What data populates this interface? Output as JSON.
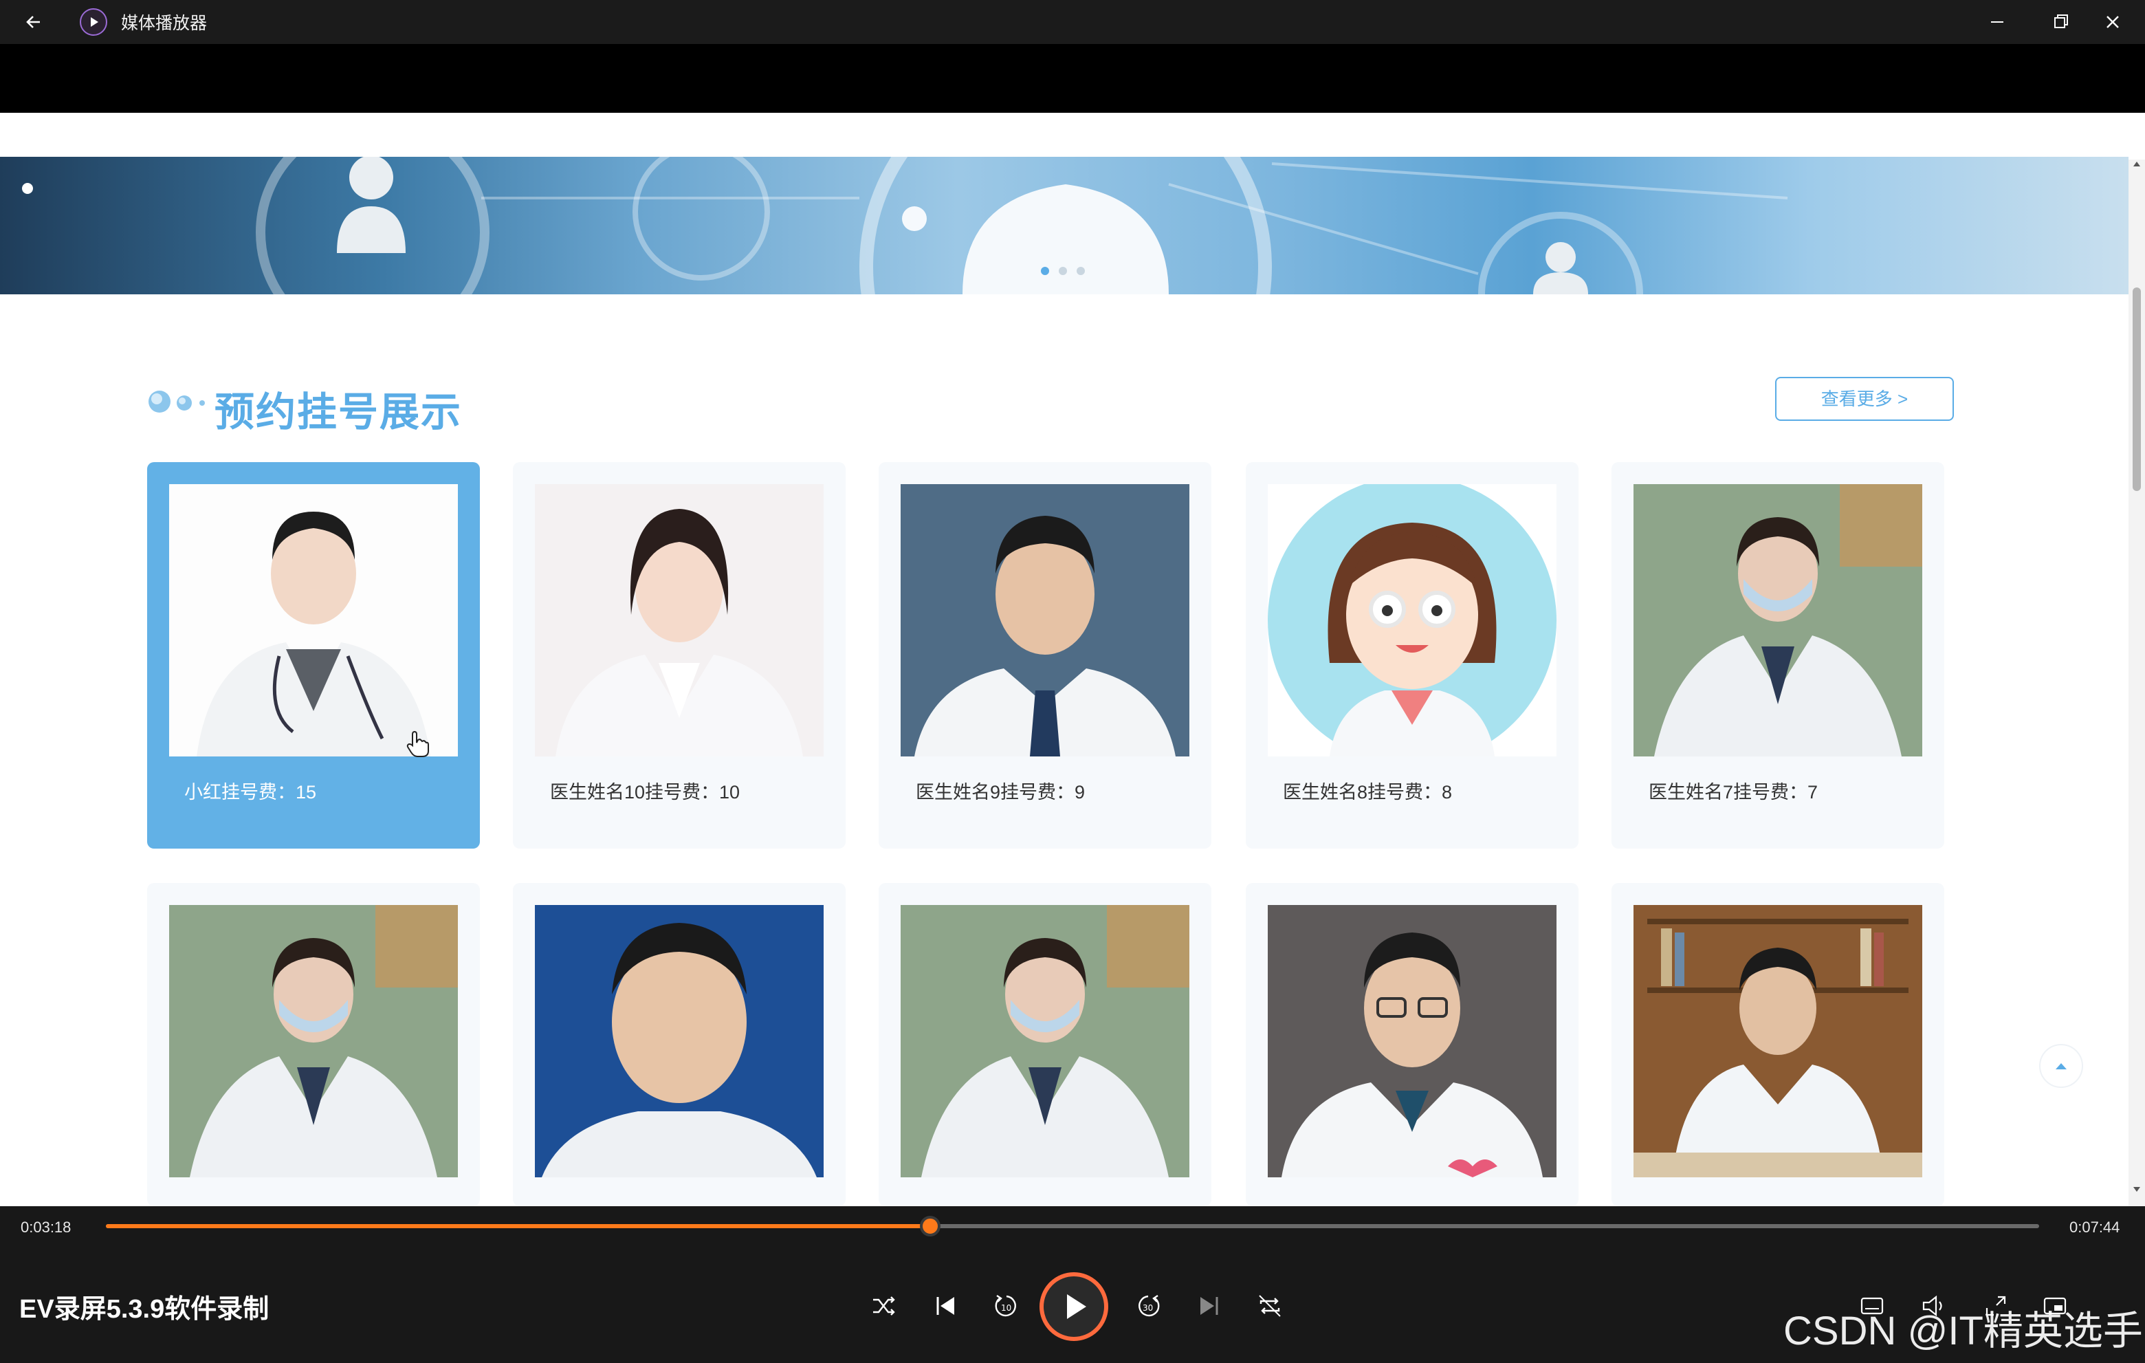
{
  "window": {
    "title": "媒体播放器"
  },
  "section": {
    "title": "预约挂号展示",
    "more_label": "查看更多 >"
  },
  "banner": {
    "dot_count": 3,
    "active_dot": 0
  },
  "doctors": [
    {
      "label": "小红挂号费：15",
      "photo": "female-doctor-stethoscope",
      "active": true
    },
    {
      "label": "医生姓名10挂号费：10",
      "photo": "female-doctor-smiling"
    },
    {
      "label": "医生姓名9挂号费：9",
      "photo": "male-doctor-tie"
    },
    {
      "label": "医生姓名8挂号费：8",
      "photo": "cartoon-female-doctor"
    },
    {
      "label": "医生姓名7挂号费：7",
      "photo": "female-doctor-mask"
    },
    {
      "label": "",
      "photo": "female-doctor-mask"
    },
    {
      "label": "",
      "photo": "male-doctor-blue-bg"
    },
    {
      "label": "",
      "photo": "female-doctor-mask"
    },
    {
      "label": "",
      "photo": "male-doctor-glasses"
    },
    {
      "label": "",
      "photo": "male-doctor-bookshelf"
    }
  ],
  "player": {
    "current_time": "0:03:18",
    "total_time": "0:07:44",
    "progress": 0.4264,
    "media_title": "EV录屏5.3.9软件录制",
    "accent_color": "#ff7a1a"
  },
  "watermark": "CSDN @IT精英选手"
}
